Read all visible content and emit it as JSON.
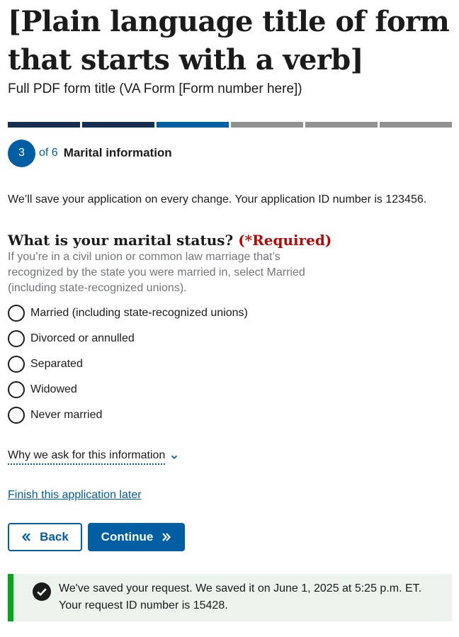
{
  "header": {
    "title": "[Plain language title of form that starts with a verb]",
    "subtitle": "Full PDF form title (VA Form [Form number here])"
  },
  "progress": {
    "current_step": 3,
    "total_steps": 6,
    "step_label": "3",
    "total_label": "of 6",
    "step_title": "Marital information",
    "colors": {
      "complete": "#162e51",
      "current": "#005ea2",
      "upcoming": "#919191"
    }
  },
  "autosave_text": "We’ll save your application on every change. Your application ID number is 123456.",
  "question": {
    "legend": "What is your marital status?",
    "required": "(*Required)",
    "hint": "If you’re in a civil union or common law marriage that’s recognized by the state you were married in, select Married (including state-recognized unions).",
    "options": [
      "Married (including state-recognized unions)",
      "Divorced or annulled",
      "Separated",
      "Widowed",
      "Never married"
    ]
  },
  "why_ask": {
    "label": "Why we ask for this information",
    "icon": "chevron-down-icon"
  },
  "finish_later": "Finish this application later",
  "buttons": {
    "back": "Back",
    "continue": "Continue"
  },
  "alert": {
    "line1": "We've saved your request. We saved it on June 1, 2025 at 5:25 p.m. ET.",
    "line2": "Your request ID number is 15428.",
    "icon": "check-circle-icon",
    "accent": "#00a91c",
    "background": "#ecf3ec"
  }
}
